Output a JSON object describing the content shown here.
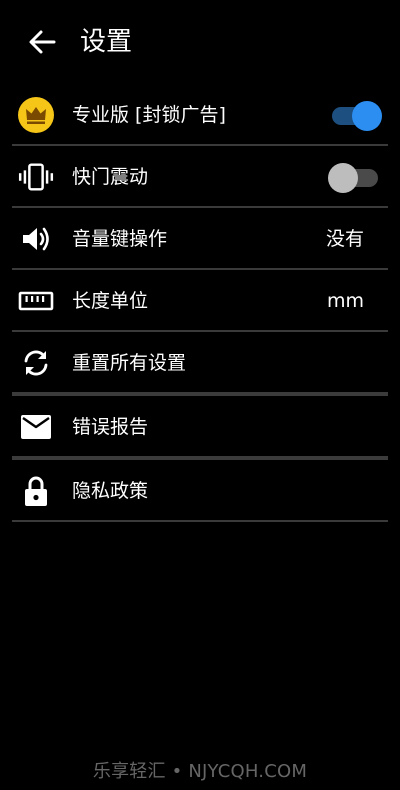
{
  "header": {
    "title": "设置"
  },
  "settings": [
    {
      "label": "专业版 [封锁广告]",
      "icon": "crown-icon",
      "control": "toggle",
      "state": "on"
    },
    {
      "label": "快门震动",
      "icon": "vibrate-icon",
      "control": "toggle",
      "state": "off"
    },
    {
      "label": "音量键操作",
      "icon": "volume-icon",
      "value": "没有"
    },
    {
      "label": "长度单位",
      "icon": "ruler-icon",
      "value": "mm"
    },
    {
      "label": "重置所有设置",
      "icon": "reset-icon"
    },
    {
      "label": "错误报告",
      "icon": "mail-icon"
    },
    {
      "label": "隐私政策",
      "icon": "lock-icon"
    }
  ],
  "watermark": "乐享轻汇 • NJYCQH.COM",
  "colors": {
    "background": "#000000",
    "accent": "#2b8ef0",
    "crown": "#f5c518",
    "divider": "#3a3a3a"
  }
}
